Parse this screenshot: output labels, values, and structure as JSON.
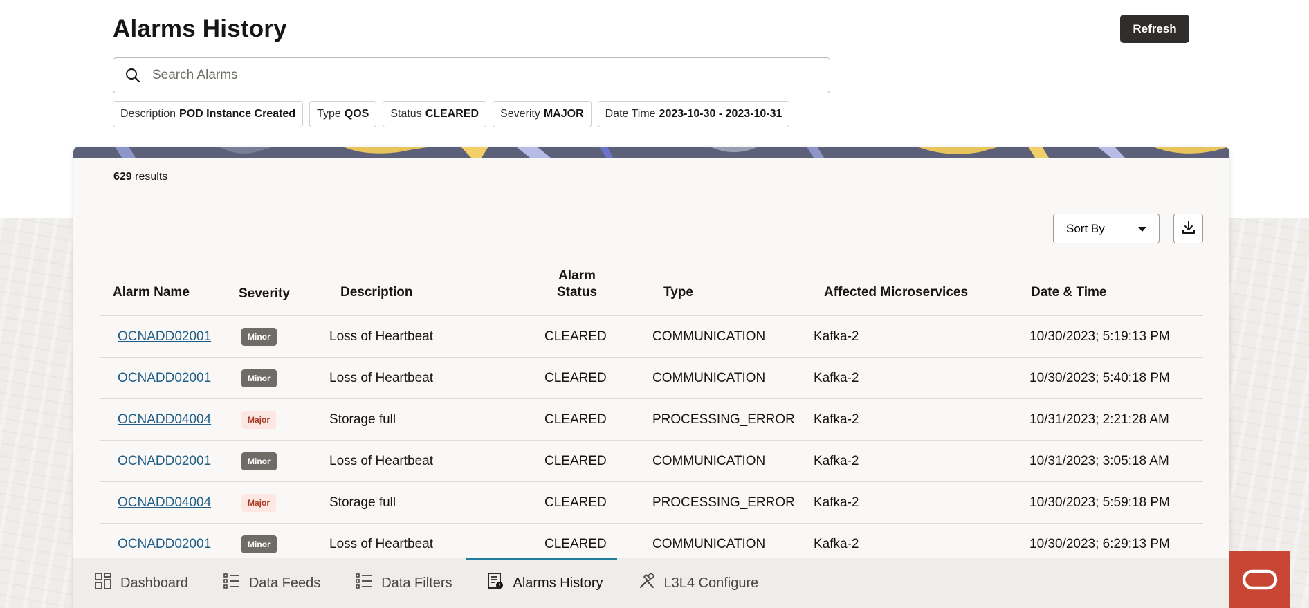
{
  "page": {
    "title": "Alarms History"
  },
  "toolbar": {
    "refresh_label": "Refresh"
  },
  "search": {
    "placeholder": "Search Alarms",
    "value": ""
  },
  "filters": [
    {
      "key": "Description",
      "value": "POD Instance Created"
    },
    {
      "key": "Type",
      "value": "QOS"
    },
    {
      "key": "Status",
      "value": "CLEARED"
    },
    {
      "key": "Severity",
      "value": "MAJOR"
    },
    {
      "key": "Date Time",
      "value": "2023-10-30 - 2023-10-31"
    }
  ],
  "results": {
    "count": "629",
    "label": "results"
  },
  "sort": {
    "label": "Sort By"
  },
  "table": {
    "headers": {
      "alarm_name": "Alarm Name",
      "severity": "Severity",
      "description": "Description",
      "alarm_status_1": "Alarm",
      "alarm_status_2": "Status",
      "type": "Type",
      "affected": "Affected Microservices",
      "datetime": "Date & Time"
    },
    "rows": [
      {
        "name": "OCNADD02001",
        "severity": "Minor",
        "description": "Loss of Heartbeat",
        "status": "CLEARED",
        "type": "COMMUNICATION",
        "service": "Kafka-2",
        "datetime": "10/30/2023; 5:19:13 PM"
      },
      {
        "name": "OCNADD02001",
        "severity": "Minor",
        "description": "Loss of Heartbeat",
        "status": "CLEARED",
        "type": "COMMUNICATION",
        "service": "Kafka-2",
        "datetime": "10/30/2023; 5:40:18 PM"
      },
      {
        "name": "OCNADD04004",
        "severity": "Major",
        "description": "Storage full",
        "status": "CLEARED",
        "type": "PROCESSING_ERROR",
        "service": "Kafka-2",
        "datetime": "10/31/2023; 2:21:28 AM"
      },
      {
        "name": "OCNADD02001",
        "severity": "Minor",
        "description": "Loss of Heartbeat",
        "status": "CLEARED",
        "type": "COMMUNICATION",
        "service": "Kafka-2",
        "datetime": "10/31/2023; 3:05:18 AM"
      },
      {
        "name": "OCNADD04004",
        "severity": "Major",
        "description": "Storage full",
        "status": "CLEARED",
        "type": "PROCESSING_ERROR",
        "service": "Kafka-2",
        "datetime": "10/30/2023; 5:59:18 PM"
      },
      {
        "name": "OCNADD02001",
        "severity": "Minor",
        "description": "Loss of Heartbeat",
        "status": "CLEARED",
        "type": "COMMUNICATION",
        "service": "Kafka-2",
        "datetime": "10/30/2023; 6:29:13 PM"
      }
    ]
  },
  "nav": {
    "items": [
      {
        "label": "Dashboard",
        "icon": "dashboard-icon",
        "active": false
      },
      {
        "label": "Data Feeds",
        "icon": "list-icon",
        "active": false
      },
      {
        "label": "Data Filters",
        "icon": "list-icon",
        "active": false
      },
      {
        "label": "Alarms History",
        "icon": "alarm-report-icon",
        "active": true
      },
      {
        "label": "L3L4 Configure",
        "icon": "tools-icon",
        "active": false
      }
    ]
  },
  "colors": {
    "accent": "#227e9e",
    "link": "#1f5d87",
    "button_dark": "#312d2a",
    "minor_badge": "#6f6b66",
    "major_badge_bg": "#fde7e3",
    "major_badge_text": "#a83a25",
    "brand": "#c74634"
  }
}
